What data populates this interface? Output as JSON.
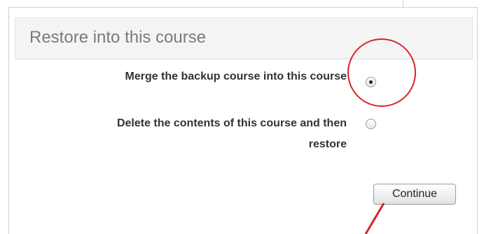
{
  "section": {
    "title": "Restore into this course"
  },
  "options": {
    "merge_label": "Merge the backup course into this course",
    "delete_label_line1": "Delete the contents of this course and then",
    "delete_label_line2": "restore",
    "selected": "merge"
  },
  "actions": {
    "continue_label": "Continue"
  },
  "annotation": {
    "highlight_color": "#d8232a"
  }
}
